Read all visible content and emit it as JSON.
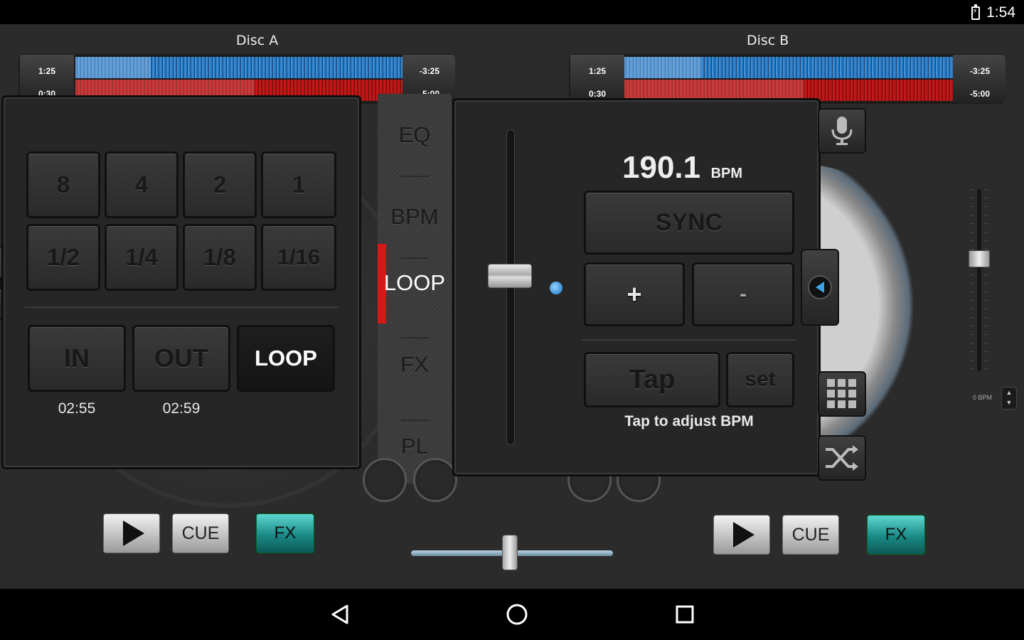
{
  "status": {
    "time": "1:54"
  },
  "deck_a": {
    "title": "Disc A",
    "time_elapsed": "1:25",
    "time_cue": "0:30",
    "time_remaining": "-3:25",
    "time_total": "-5:00",
    "play_label": "",
    "cue_label": "CUE",
    "fx_label": "FX"
  },
  "deck_b": {
    "title": "Disc B",
    "time_elapsed": "1:25",
    "time_cue": "0:30",
    "time_remaining": "-3:25",
    "time_total": "-5:00",
    "cue_label": "CUE",
    "fx_label": "FX"
  },
  "loop_panel": {
    "beat_buttons": [
      "8",
      "4",
      "2",
      "1",
      "1/2",
      "1/4",
      "1/8",
      "1/16"
    ],
    "in_label": "IN",
    "out_label": "OUT",
    "loop_label": "LOOP",
    "in_time": "02:55",
    "out_time": "02:59"
  },
  "tabs": [
    "EQ",
    "BPM",
    "LOOP",
    "FX",
    "PL"
  ],
  "active_tab": "LOOP",
  "bpm_panel": {
    "bpm_value": "190.1",
    "bpm_unit": "BPM",
    "sync_label": "SYNC",
    "plus_label": "+",
    "minus_label": "-",
    "tap_label": "Tap",
    "set_label": "set",
    "hint": "Tap to adjust BPM"
  },
  "right_pitch": {
    "bpm_label": "0 BPM",
    "up": "▲",
    "down": "▼"
  },
  "crossfader": {
    "position": 0.45
  },
  "icons": [
    "mic-icon",
    "grid-icon",
    "shuffle-icon",
    "left-arrow-icon",
    "right-arrow-icon"
  ],
  "colors": {
    "accent_red": "#d51818",
    "fx_teal": "#1a8a86",
    "wave_blue": "#2b7bc7",
    "wave_red": "#b01515"
  }
}
